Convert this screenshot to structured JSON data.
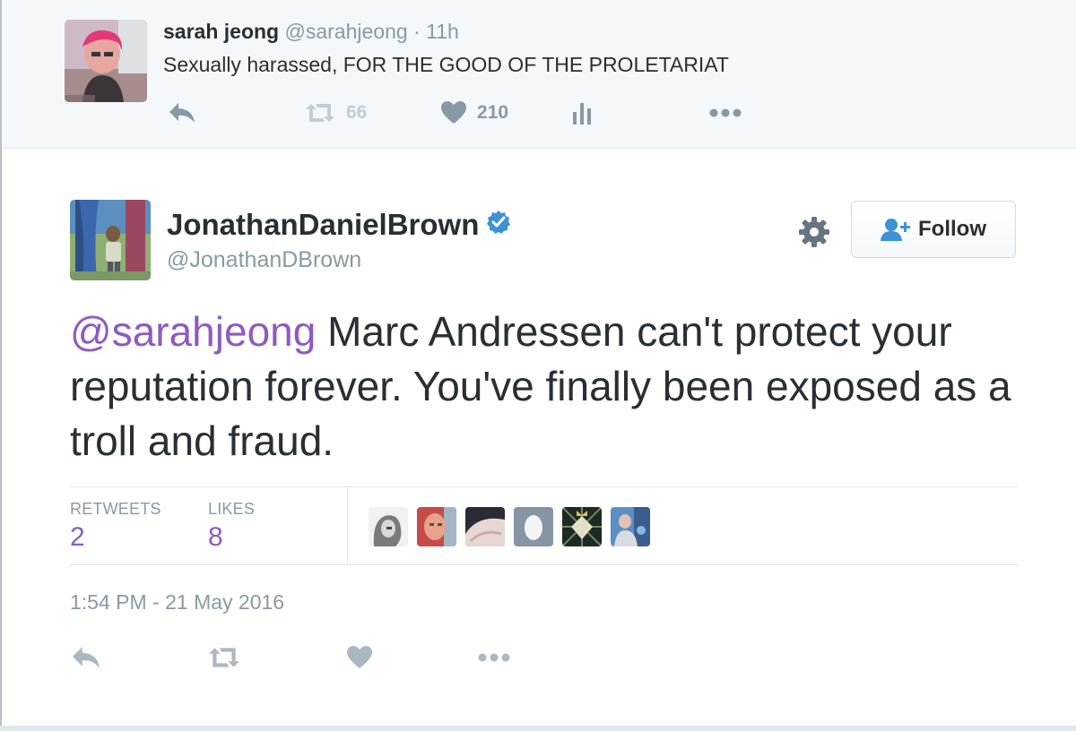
{
  "parent_tweet": {
    "name": "sarah jeong",
    "handle": "@sarahjeong",
    "separator": "·",
    "time": "11h",
    "text": "Sexually harassed, FOR THE GOOD OF THE PROLETARIAT",
    "actions": {
      "reply_icon": "reply-icon",
      "retweet_icon": "retweet-icon",
      "retweet_count": "66",
      "like_icon": "heart-icon",
      "like_count": "210",
      "analytics_icon": "analytics-icon",
      "more_icon": "more-dots-icon"
    }
  },
  "main_tweet": {
    "name": "JonathanDanielBrown",
    "verified": true,
    "handle": "@JonathanDBrown",
    "follow_label": "Follow",
    "mention": "@sarahjeong",
    "text": " Marc Andressen can't protect your reputation forever. You've finally been exposed as a troll and fraud.",
    "stats": {
      "retweets_label": "RETWEETS",
      "retweets_value": "2",
      "likes_label": "LIKES",
      "likes_value": "8"
    },
    "liker_avatars": 6,
    "timestamp": "1:54 PM - 21 May 2016"
  },
  "colors": {
    "accent_purple": "#8e5bbf",
    "verified_blue": "#3d92d6",
    "muted_gray": "#8899a6",
    "icon_gray": "#aab8c2",
    "parent_bg": "#f5f8fa"
  }
}
